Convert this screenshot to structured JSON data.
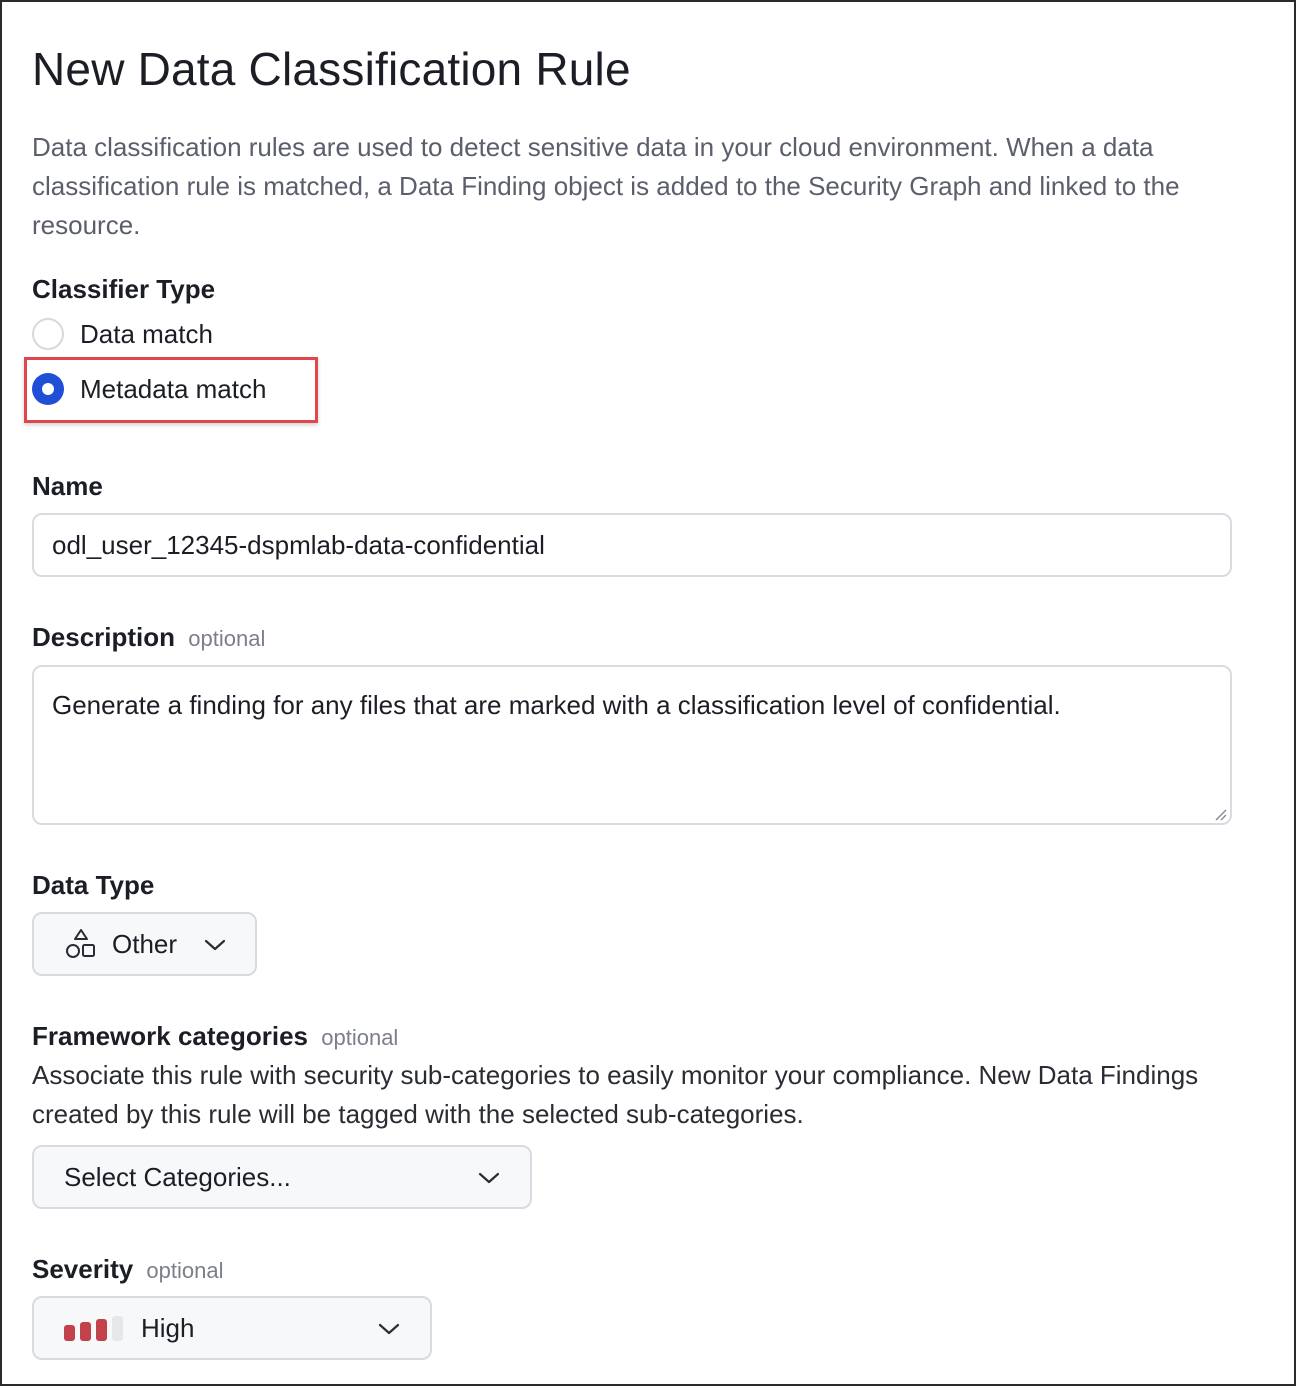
{
  "page": {
    "title": "New Data Classification Rule",
    "intro": "Data classification rules are used to detect sensitive data in your cloud environment. When a data classification rule is matched, a Data Finding object is added to the Security Graph and linked to the resource."
  },
  "classifier": {
    "label": "Classifier Type",
    "options": [
      {
        "label": "Data match",
        "selected": false
      },
      {
        "label": "Metadata match",
        "selected": true
      }
    ]
  },
  "name_field": {
    "label": "Name",
    "value": "odl_user_12345-dspmlab-data-confidential"
  },
  "description_field": {
    "label": "Description",
    "optional": "optional",
    "value": "Generate a finding for any files that are marked with a classification level of confidential."
  },
  "data_type": {
    "label": "Data Type",
    "selected": "Other",
    "icon": "shapes-icon"
  },
  "framework": {
    "label": "Framework categories",
    "optional": "optional",
    "help": "Associate this rule with security sub-categories to easily monitor your compliance. New Data Findings created by this rule will be tagged with the selected sub-categories.",
    "placeholder": "Select Categories..."
  },
  "severity": {
    "label": "Severity",
    "optional": "optional",
    "selected": "High",
    "level": 3,
    "max_level": 4,
    "active_color": "#c2414b",
    "inactive_color": "#e6e7eb"
  },
  "colors": {
    "radio_selected": "#1f4fd6",
    "highlight_border": "#e0474c"
  }
}
